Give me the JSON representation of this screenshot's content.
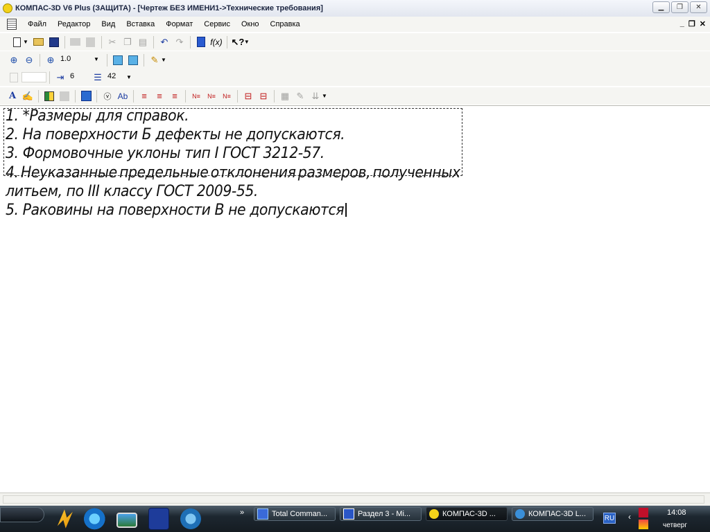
{
  "window": {
    "title": "КОМПАС-3D V6 Plus (ЗАЩИТА) - [Чертеж БЕЗ ИМЕНИ1->Технические требования]"
  },
  "menu": {
    "items": [
      {
        "first": "Ф",
        "rest": "айл"
      },
      {
        "first": "Р",
        "rest": "едактор"
      },
      {
        "first": "В",
        "rest": "ид"
      },
      {
        "first": "Вст",
        "rest": "авка",
        "underline_index": 3
      },
      {
        "first": "Фо",
        "rest": "рмат"
      },
      {
        "first": "С",
        "rest": "ервис"
      },
      {
        "first": "О",
        "rest": "кно"
      },
      {
        "first": "С",
        "rest": "правка"
      }
    ],
    "labels": [
      "Файл",
      "Редактор",
      "Вид",
      "Вставка",
      "Формат",
      "Сервис",
      "Окно",
      "Справка"
    ]
  },
  "toolbar_view": {
    "zoom_value": "1.0"
  },
  "toolbar_format": {
    "indent_value": "6",
    "spacing_value": "42"
  },
  "document": {
    "lines": [
      "1.  *Размеры для справок.",
      "2.  На поверхности Б дефекты не допускаются.",
      "3.  Формовочные уклоны тип I ГОСТ 3212-57.",
      "4.  Неуказанные предельные отклонения размеров, полученных",
      "литьем, по III классу ГОСТ 2009-55.",
      "5.  Раковины на поверхности В не допускаются"
    ],
    "line4_words": [
      "4.",
      "Неуказанные",
      "предельные",
      "отклонения",
      "размеров,",
      "полученных"
    ]
  },
  "taskbar": {
    "more": "»",
    "tasks": [
      {
        "label": "Total Comman..."
      },
      {
        "label": "Раздел 3 - Mi..."
      },
      {
        "label": "КОМПАС-3D ..."
      },
      {
        "label": "КОМПАС-3D L..."
      }
    ],
    "language": "RU",
    "clock_time": "14:08",
    "clock_day": "четверг"
  },
  "colors": {
    "taskbar_dark": "#1d2730",
    "title_text": "#1a2440",
    "document_bg": "#ffffff"
  }
}
